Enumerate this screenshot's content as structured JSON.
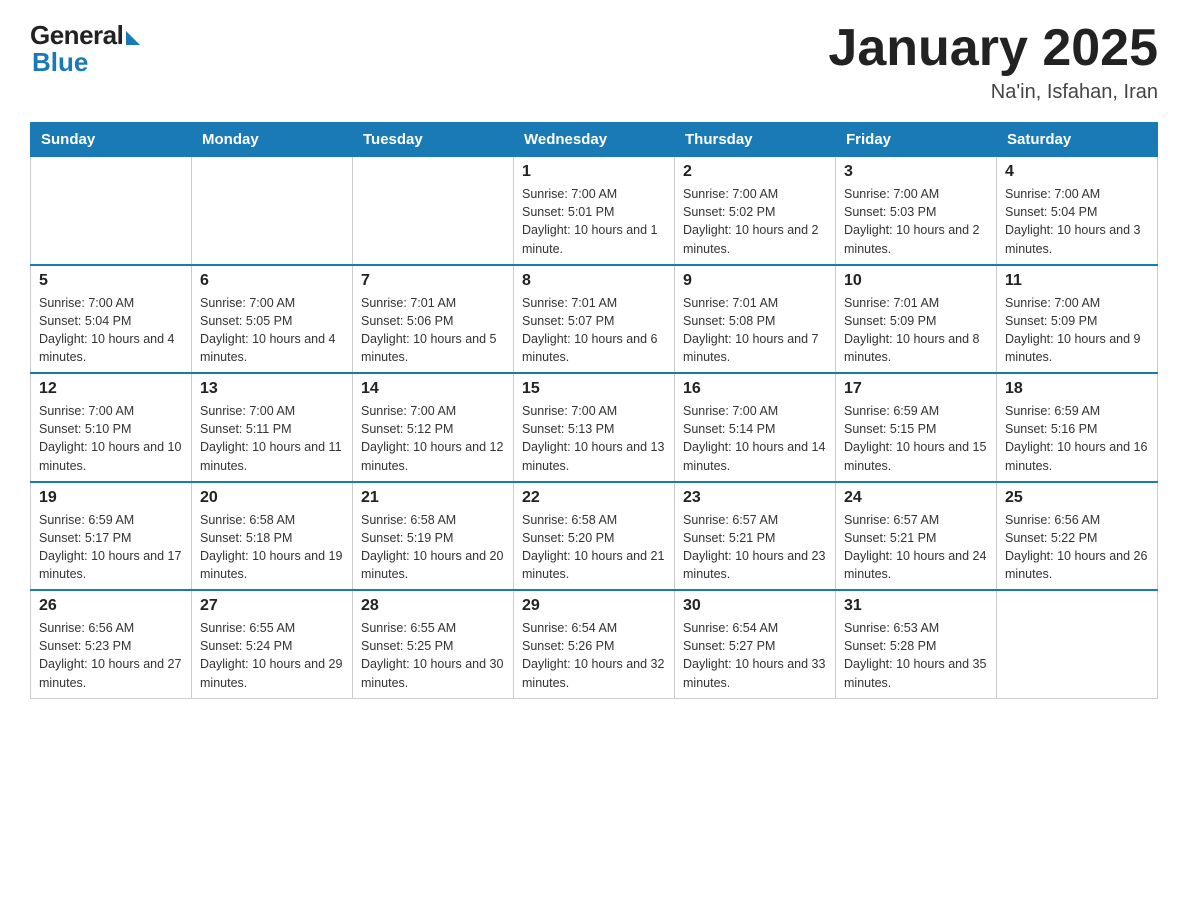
{
  "logo": {
    "general": "General",
    "blue": "Blue"
  },
  "title": "January 2025",
  "subtitle": "Na'in, Isfahan, Iran",
  "weekdays": [
    "Sunday",
    "Monday",
    "Tuesday",
    "Wednesday",
    "Thursday",
    "Friday",
    "Saturday"
  ],
  "weeks": [
    [
      {
        "day": "",
        "info": ""
      },
      {
        "day": "",
        "info": ""
      },
      {
        "day": "",
        "info": ""
      },
      {
        "day": "1",
        "info": "Sunrise: 7:00 AM\nSunset: 5:01 PM\nDaylight: 10 hours and 1 minute."
      },
      {
        "day": "2",
        "info": "Sunrise: 7:00 AM\nSunset: 5:02 PM\nDaylight: 10 hours and 2 minutes."
      },
      {
        "day": "3",
        "info": "Sunrise: 7:00 AM\nSunset: 5:03 PM\nDaylight: 10 hours and 2 minutes."
      },
      {
        "day": "4",
        "info": "Sunrise: 7:00 AM\nSunset: 5:04 PM\nDaylight: 10 hours and 3 minutes."
      }
    ],
    [
      {
        "day": "5",
        "info": "Sunrise: 7:00 AM\nSunset: 5:04 PM\nDaylight: 10 hours and 4 minutes."
      },
      {
        "day": "6",
        "info": "Sunrise: 7:00 AM\nSunset: 5:05 PM\nDaylight: 10 hours and 4 minutes."
      },
      {
        "day": "7",
        "info": "Sunrise: 7:01 AM\nSunset: 5:06 PM\nDaylight: 10 hours and 5 minutes."
      },
      {
        "day": "8",
        "info": "Sunrise: 7:01 AM\nSunset: 5:07 PM\nDaylight: 10 hours and 6 minutes."
      },
      {
        "day": "9",
        "info": "Sunrise: 7:01 AM\nSunset: 5:08 PM\nDaylight: 10 hours and 7 minutes."
      },
      {
        "day": "10",
        "info": "Sunrise: 7:01 AM\nSunset: 5:09 PM\nDaylight: 10 hours and 8 minutes."
      },
      {
        "day": "11",
        "info": "Sunrise: 7:00 AM\nSunset: 5:09 PM\nDaylight: 10 hours and 9 minutes."
      }
    ],
    [
      {
        "day": "12",
        "info": "Sunrise: 7:00 AM\nSunset: 5:10 PM\nDaylight: 10 hours and 10 minutes."
      },
      {
        "day": "13",
        "info": "Sunrise: 7:00 AM\nSunset: 5:11 PM\nDaylight: 10 hours and 11 minutes."
      },
      {
        "day": "14",
        "info": "Sunrise: 7:00 AM\nSunset: 5:12 PM\nDaylight: 10 hours and 12 minutes."
      },
      {
        "day": "15",
        "info": "Sunrise: 7:00 AM\nSunset: 5:13 PM\nDaylight: 10 hours and 13 minutes."
      },
      {
        "day": "16",
        "info": "Sunrise: 7:00 AM\nSunset: 5:14 PM\nDaylight: 10 hours and 14 minutes."
      },
      {
        "day": "17",
        "info": "Sunrise: 6:59 AM\nSunset: 5:15 PM\nDaylight: 10 hours and 15 minutes."
      },
      {
        "day": "18",
        "info": "Sunrise: 6:59 AM\nSunset: 5:16 PM\nDaylight: 10 hours and 16 minutes."
      }
    ],
    [
      {
        "day": "19",
        "info": "Sunrise: 6:59 AM\nSunset: 5:17 PM\nDaylight: 10 hours and 17 minutes."
      },
      {
        "day": "20",
        "info": "Sunrise: 6:58 AM\nSunset: 5:18 PM\nDaylight: 10 hours and 19 minutes."
      },
      {
        "day": "21",
        "info": "Sunrise: 6:58 AM\nSunset: 5:19 PM\nDaylight: 10 hours and 20 minutes."
      },
      {
        "day": "22",
        "info": "Sunrise: 6:58 AM\nSunset: 5:20 PM\nDaylight: 10 hours and 21 minutes."
      },
      {
        "day": "23",
        "info": "Sunrise: 6:57 AM\nSunset: 5:21 PM\nDaylight: 10 hours and 23 minutes."
      },
      {
        "day": "24",
        "info": "Sunrise: 6:57 AM\nSunset: 5:21 PM\nDaylight: 10 hours and 24 minutes."
      },
      {
        "day": "25",
        "info": "Sunrise: 6:56 AM\nSunset: 5:22 PM\nDaylight: 10 hours and 26 minutes."
      }
    ],
    [
      {
        "day": "26",
        "info": "Sunrise: 6:56 AM\nSunset: 5:23 PM\nDaylight: 10 hours and 27 minutes."
      },
      {
        "day": "27",
        "info": "Sunrise: 6:55 AM\nSunset: 5:24 PM\nDaylight: 10 hours and 29 minutes."
      },
      {
        "day": "28",
        "info": "Sunrise: 6:55 AM\nSunset: 5:25 PM\nDaylight: 10 hours and 30 minutes."
      },
      {
        "day": "29",
        "info": "Sunrise: 6:54 AM\nSunset: 5:26 PM\nDaylight: 10 hours and 32 minutes."
      },
      {
        "day": "30",
        "info": "Sunrise: 6:54 AM\nSunset: 5:27 PM\nDaylight: 10 hours and 33 minutes."
      },
      {
        "day": "31",
        "info": "Sunrise: 6:53 AM\nSunset: 5:28 PM\nDaylight: 10 hours and 35 minutes."
      },
      {
        "day": "",
        "info": ""
      }
    ]
  ]
}
